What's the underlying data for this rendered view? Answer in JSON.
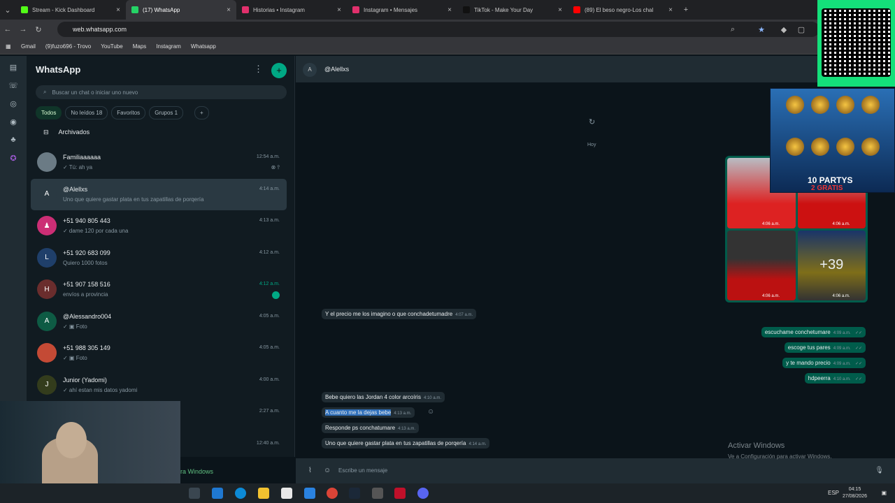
{
  "tabs": [
    {
      "label": "Stream - Kick Dashboard",
      "color": "#53fc18"
    },
    {
      "label": "(17) WhatsApp",
      "color": "#25d366"
    },
    {
      "label": "Historias • Instagram",
      "color": "#e1306c"
    },
    {
      "label": "Instagram • Mensajes",
      "color": "#e1306c"
    },
    {
      "label": "TikTok - Make Your Day",
      "color": "#111111"
    },
    {
      "label": "(89) El beso negro-Los chal",
      "color": "#ff0000"
    }
  ],
  "url": "web.whatsapp.com",
  "bookmarks": [
    "Gmail",
    "(9)fuzo696 - Trovo",
    "YouTube",
    "Maps",
    "Instagram",
    "Whatsapp"
  ],
  "sidebar": {
    "title": "WhatsApp",
    "search_placeholder": "Buscar un chat o iniciar uno nuevo",
    "chips": [
      "Todos",
      "No leídos 18",
      "Favoritos",
      "Grupos 1"
    ],
    "archived": "Archivados",
    "chats": [
      {
        "name": "Familiaaaaaa",
        "preview": "✓ Tú: ah ya",
        "time": "12:54 a.m.",
        "avatar": "#6b7b85",
        "initial": ""
      },
      {
        "name": "@Alellxs",
        "preview": "Uno que quiere gastar plata en tus zapatillas de porqería",
        "time": "4:14 a.m.",
        "avatar": "#2a3942",
        "initial": "A"
      },
      {
        "name": "+51 940 805 443",
        "preview": "✓ dame 120 por cada una",
        "time": "4:13 a.m.",
        "avatar": "#cc2e75",
        "initial": "♟"
      },
      {
        "name": "+51 920 683 099",
        "preview": "Quiero 1000 fotos",
        "time": "4:12 a.m.",
        "avatar": "#1f3f6a",
        "initial": "L"
      },
      {
        "name": "+51 907 158 516",
        "preview": "envíos a provincia",
        "time": "4:12 a.m.",
        "avatar": "#6a2d2d",
        "initial": "H"
      },
      {
        "name": "@Alessandro004",
        "preview": "✓ ▣ Foto",
        "time": "4:05 a.m.",
        "avatar": "#0e5b44",
        "initial": "A"
      },
      {
        "name": "+51 988 305 149",
        "preview": "✓ ▣ Foto",
        "time": "4:05 a.m.",
        "avatar": "#c44a35",
        "initial": ""
      },
      {
        "name": "Junior (Yadomi)",
        "preview": "✓ ahí estan mis datos yadomi",
        "time": "4:00 a.m.",
        "avatar": "#333c1c",
        "initial": "J"
      },
      {
        "name": "",
        "preview": "",
        "time": "2:27 a.m.",
        "avatar": "#111b21",
        "initial": ""
      },
      {
        "name": "",
        "preview": "",
        "time": "12:40 a.m.",
        "avatar": "#111b21",
        "initial": ""
      }
    ]
  },
  "chat": {
    "contact": "@Alellxs",
    "avatar_initial": "A",
    "day": "Hoy",
    "gallery_times": [
      "4:06 a.m.",
      "4:06 a.m.",
      "4:06 a.m.",
      "4:06 a.m."
    ],
    "gallery_more": "+39",
    "incoming_1": {
      "text": "Y el precio me los imagino o que conchadetumadre",
      "time": "4:07 a.m."
    },
    "outgoing": [
      {
        "text": "escuchame conchetumare",
        "time": "4:09 a.m."
      },
      {
        "text": "escoge tus pares",
        "time": "4:09 a.m."
      },
      {
        "text": "y te mando precio",
        "time": "4:09 a.m."
      },
      {
        "text": "hdpeerra",
        "time": "4:10 a.m."
      }
    ],
    "incoming": [
      {
        "text": "Bebe quiero las Jordan 4 color arcoíris",
        "time": "4:10 a.m."
      },
      {
        "text": "A cuanto me la dejas bebe",
        "time": "4:13 a.m."
      },
      {
        "text": "Responde ps conchatumare",
        "time": "4:13 a.m."
      },
      {
        "text": "Uno que quiere gastar plata en tus zapatillas de porqería",
        "time": "4:14 a.m."
      }
    ],
    "compose_placeholder": "Escribe un mensaje"
  },
  "windows": {
    "activate": "Activar Windows",
    "activate_sub": "Ve a Configuración para activar Windows.",
    "tail": "ra Windows"
  },
  "promo": {
    "headline": "10 PARTYS",
    "sub": "2 GRATIS"
  },
  "taskbar": {
    "lang": "ESP",
    "time": "04:15",
    "date": "27/08/2026"
  }
}
